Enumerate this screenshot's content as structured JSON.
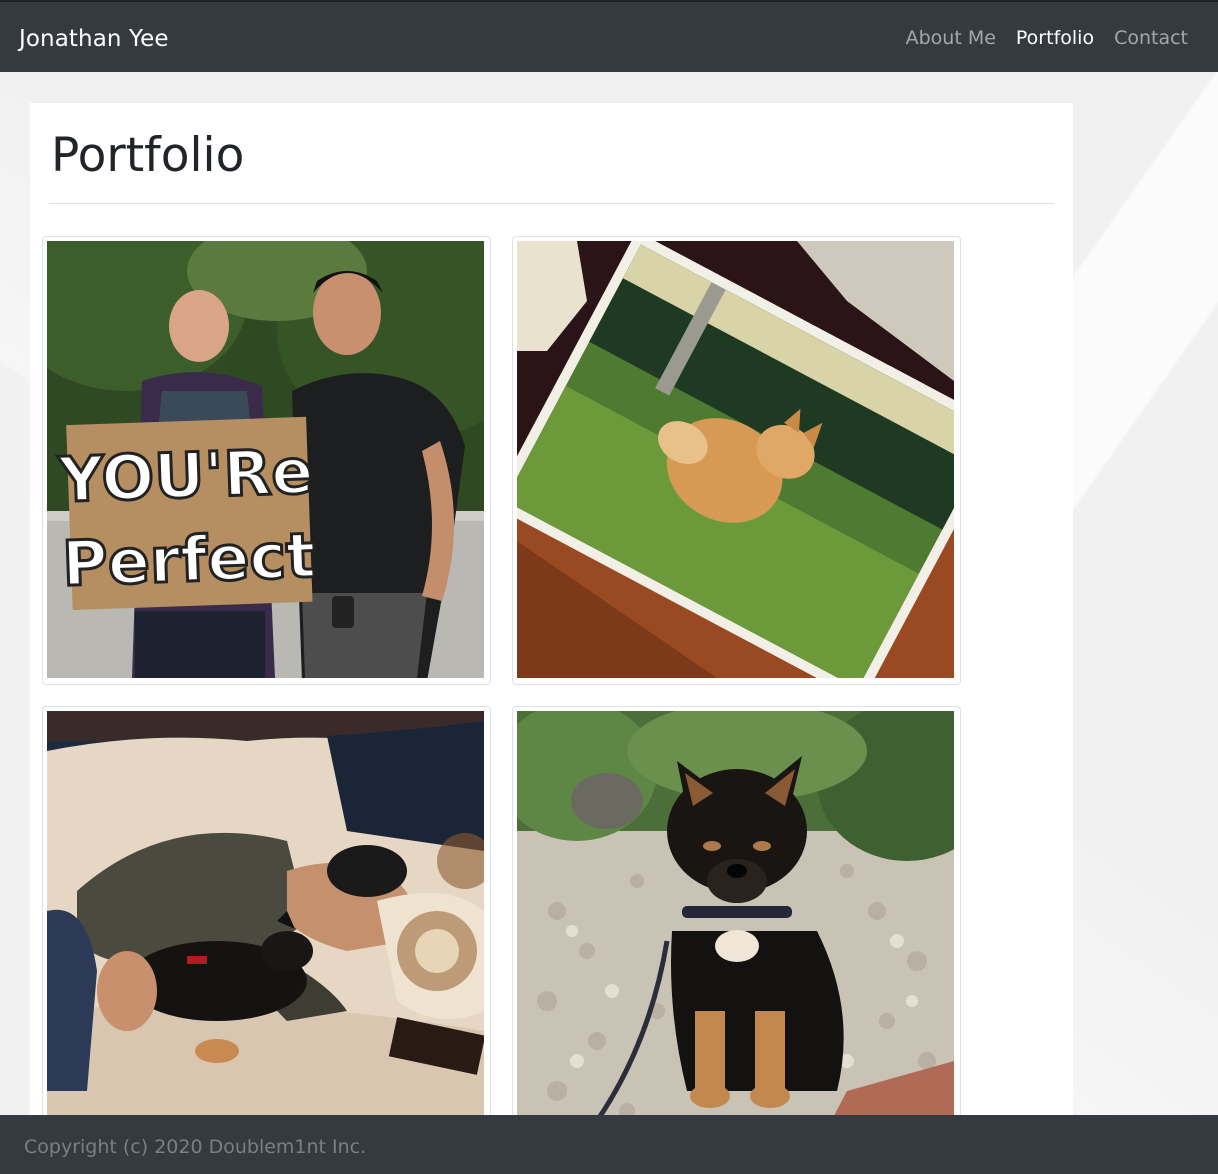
{
  "navbar": {
    "brand": "Jonathan Yee",
    "links": [
      {
        "label": "About Me",
        "active": false
      },
      {
        "label": "Portfolio",
        "active": true
      },
      {
        "label": "Contact",
        "active": false
      }
    ]
  },
  "main": {
    "title": "Portfolio",
    "photos": [
      {
        "subject": "two men holding a sign",
        "sign_text_line1": "YOU'Re",
        "sign_text_line2": "Perfect"
      },
      {
        "subject": "photo print of an orange dog on grass"
      },
      {
        "subject": "man sleeping on couch with puppy"
      },
      {
        "subject": "black and tan puppy sitting on pebbles"
      }
    ]
  },
  "footer": {
    "text": "Copyright (c) 2020 Doublem1nt Inc."
  },
  "colors": {
    "navbar_bg": "#343a40",
    "footer_bg": "#343a40",
    "page_bg": "#f2f2f3",
    "card_bg": "#ffffff",
    "link_inactive": "#9a9da1",
    "link_active": "#ffffff"
  }
}
